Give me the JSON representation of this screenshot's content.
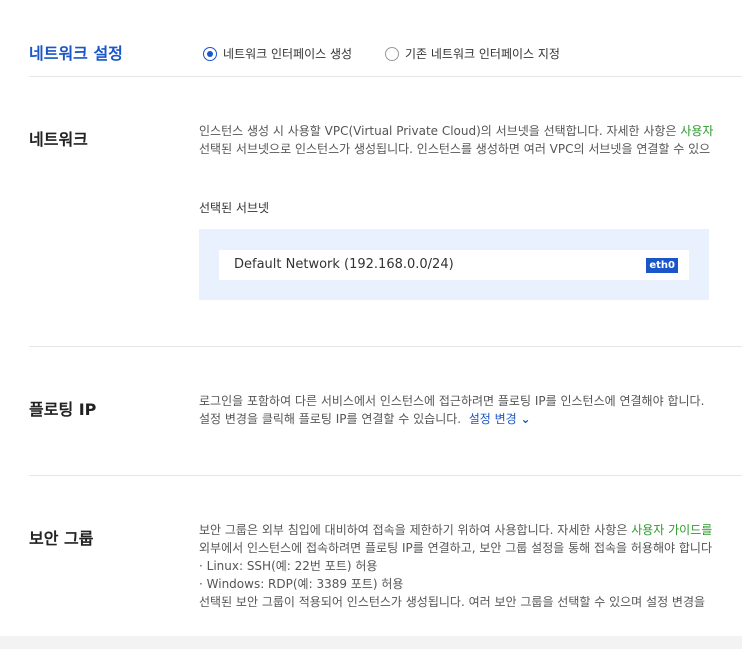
{
  "network_settings": {
    "title": "네트워크 설정",
    "options": [
      {
        "label": "네트워크 인터페이스 생성",
        "checked": true
      },
      {
        "label": "기존 네트워크 인터페이스 지정",
        "checked": false
      }
    ]
  },
  "network": {
    "title": "네트워크",
    "desc_line1_pre": "인스턴스 생성 시 사용할 VPC(Virtual Private Cloud)의 서브넷을 선택합니다. 자세한 사항은 ",
    "desc_line1_link": "사용자",
    "desc_line2": "선택된 서브넷으로 인스턴스가 생성됩니다. 인스턴스를 생성하면 여러 VPC의 서브넷을 연결할 수 있으",
    "selected_subnet_label": "선택된 서브넷",
    "subnet_name": "Default Network (192.168.0.0/24)",
    "subnet_badge": "eth0"
  },
  "floating_ip": {
    "title": "플로팅 IP",
    "desc_line1": "로그인을 포함하여 다른 서비스에서 인스턴스에 접근하려면 플로팅 IP를 인스턴스에 연결해야 합니다.",
    "desc_line2_pre": "설정 변경을 클릭해 플로팅 IP를 연결할 수 있습니다.",
    "change_link": "설정 변경",
    "chevron_glyph": "⌄"
  },
  "security_group": {
    "title": "보안 그룹",
    "desc_line1_pre": "보안 그룹은 외부 침입에 대비하여 접속을 제한하기 위하여 사용합니다. 자세한 사항은 ",
    "desc_line1_link": "사용자 가이드를",
    "desc_line2": "외부에서 인스턴스에 접속하려면 플로팅 IP를 연결하고, 보안 그룹 설정을 통해 접속을 허용해야 합니다",
    "desc_line3": "· Linux: SSH(예: 22번 포트) 허용",
    "desc_line4": "· Windows: RDP(예: 3389 포트) 허용",
    "desc_line5": "선택된 보안 그룹이 적용되어 인스턴스가 생성됩니다. 여러 보안 그룹을 선택할 수 있으며 설정 변경을"
  },
  "colors": {
    "accent": "#1a56c8",
    "link_green": "#2e9a2e",
    "subnet_bg": "#eaf1fe"
  }
}
